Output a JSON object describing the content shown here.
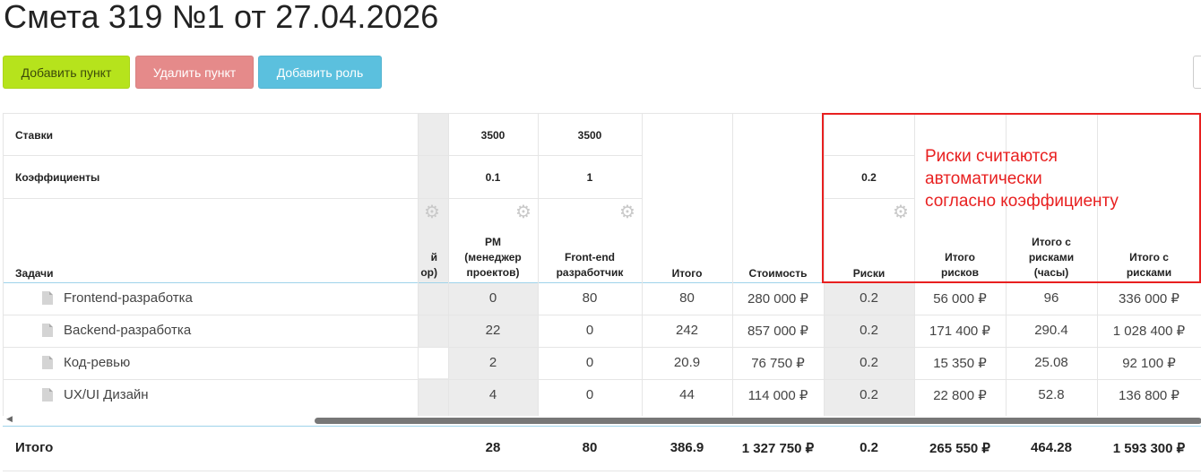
{
  "page": {
    "title": "Смета 319 №1 от 27.04.2026"
  },
  "toolbar": {
    "add_item": "Добавить пункт",
    "delete_item": "Удалить пункт",
    "add_role": "Добавить роль"
  },
  "table": {
    "row_labels": {
      "rates": "Ставки",
      "coefficients": "Коэффициенты",
      "tasks": "Задачи"
    },
    "rates": {
      "pm": "3500",
      "frontend": "3500"
    },
    "coefficients": {
      "pm": "0.1",
      "frontend": "1",
      "risks": "0.2"
    },
    "headers": {
      "hidden_role_part1": "й",
      "hidden_role_part2": "ор)",
      "pm_line1": "PM",
      "pm_line2": "(менеджер",
      "pm_line3": "проектов)",
      "frontend_line1": "Front-end",
      "frontend_line2": "разработчик",
      "total": "Итого",
      "cost": "Стоимость",
      "risks": "Риски",
      "risk_total_line1": "Итого",
      "risk_total_line2": "рисков",
      "hours_line1": "Итого с",
      "hours_line2": "рисками",
      "hours_line3": "(часы)",
      "total_risk_line1": "Итого с",
      "total_risk_line2": "рисками"
    },
    "rows": [
      {
        "task": "Frontend-разработка",
        "pm": "0",
        "frontend": "80",
        "total": "80",
        "cost": "280 000 ₽",
        "risks": "0.2",
        "risk_total": "56 000 ₽",
        "hours": "96",
        "total_with_risks": "336 000 ₽"
      },
      {
        "task": "Backend-разработка",
        "pm": "22",
        "frontend": "0",
        "total": "242",
        "cost": "857 000 ₽",
        "risks": "0.2",
        "risk_total": "171 400 ₽",
        "hours": "290.4",
        "total_with_risks": "1 028 400 ₽"
      },
      {
        "task": "Код-ревью",
        "pm": "2",
        "frontend": "0",
        "total": "20.9",
        "cost": "76 750 ₽",
        "risks": "0.2",
        "risk_total": "15 350 ₽",
        "hours": "25.08",
        "total_with_risks": "92 100 ₽"
      },
      {
        "task": "UX/UI Дизайн",
        "pm": "4",
        "frontend": "0",
        "total": "44",
        "cost": "114 000 ₽",
        "risks": "0.2",
        "risk_total": "22 800 ₽",
        "hours": "52.8",
        "total_with_risks": "136 800 ₽"
      }
    ],
    "footer": {
      "label": "Итого",
      "pm": "28",
      "frontend": "80",
      "total": "386.9",
      "cost": "1 327 750 ₽",
      "risks": "0.2",
      "risk_total": "265 550 ₽",
      "hours": "464.28",
      "total_with_risks": "1 593 300 ₽"
    }
  },
  "annotation": {
    "line1": "Риски считаются",
    "line2": "автоматически",
    "line3": "согласно коэффициенту",
    "color": "#e82020"
  },
  "icons": {
    "settings": "gear-icon",
    "task": "document-icon"
  }
}
